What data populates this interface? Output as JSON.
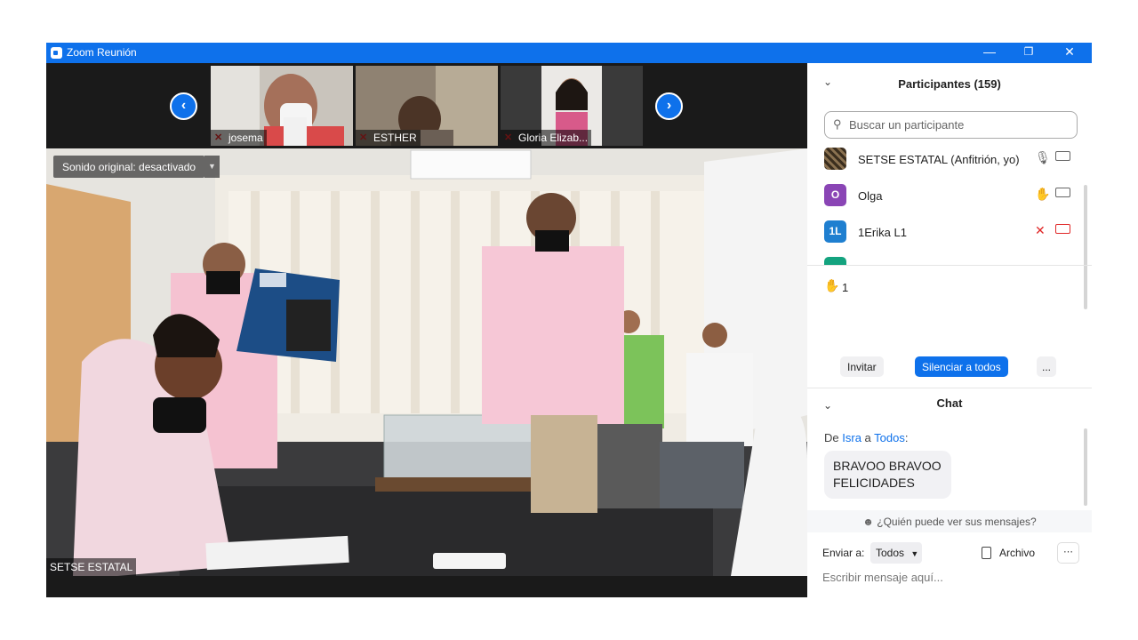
{
  "window": {
    "title": "Zoom Reunión"
  },
  "thumbnails": [
    {
      "name": "josema"
    },
    {
      "name": "ESTHER"
    },
    {
      "name": "Gloria Elizab..."
    }
  ],
  "main_video": {
    "sound_label": "Sonido original: desactivado",
    "speaker_name": "SETSE ESTATAL"
  },
  "participants": {
    "title": "Participantes (159)",
    "search_placeholder": "Buscar un participante",
    "list": [
      {
        "name": "SETSE ESTATAL (Anfitrión, yo)",
        "initials": "",
        "color": "#5b4a2e"
      },
      {
        "name": "Olga",
        "initials": "O",
        "color": "#8a45b5"
      },
      {
        "name": "1Erika L1",
        "initials": "1L",
        "color": "#1f7fd0"
      }
    ],
    "raised_hands": "1",
    "buttons": {
      "invite": "Invitar",
      "mute_all": "Silenciar a todos",
      "more": "..."
    }
  },
  "chat": {
    "title": "Chat",
    "from_prefix": "De",
    "from": "Isra",
    "to_word": "a",
    "to": "Todos",
    "message": "BRAVOO BRAVOO FELICIDADES",
    "who_can_see": "¿Quién puede ver sus mensajes?",
    "send_to_label": "Enviar a:",
    "send_to_value": "Todos",
    "file_label": "Archivo",
    "input_placeholder": "Escribir mensaje aquí..."
  },
  "colors": {
    "accent": "#0e71eb",
    "muted": "#e02828"
  }
}
